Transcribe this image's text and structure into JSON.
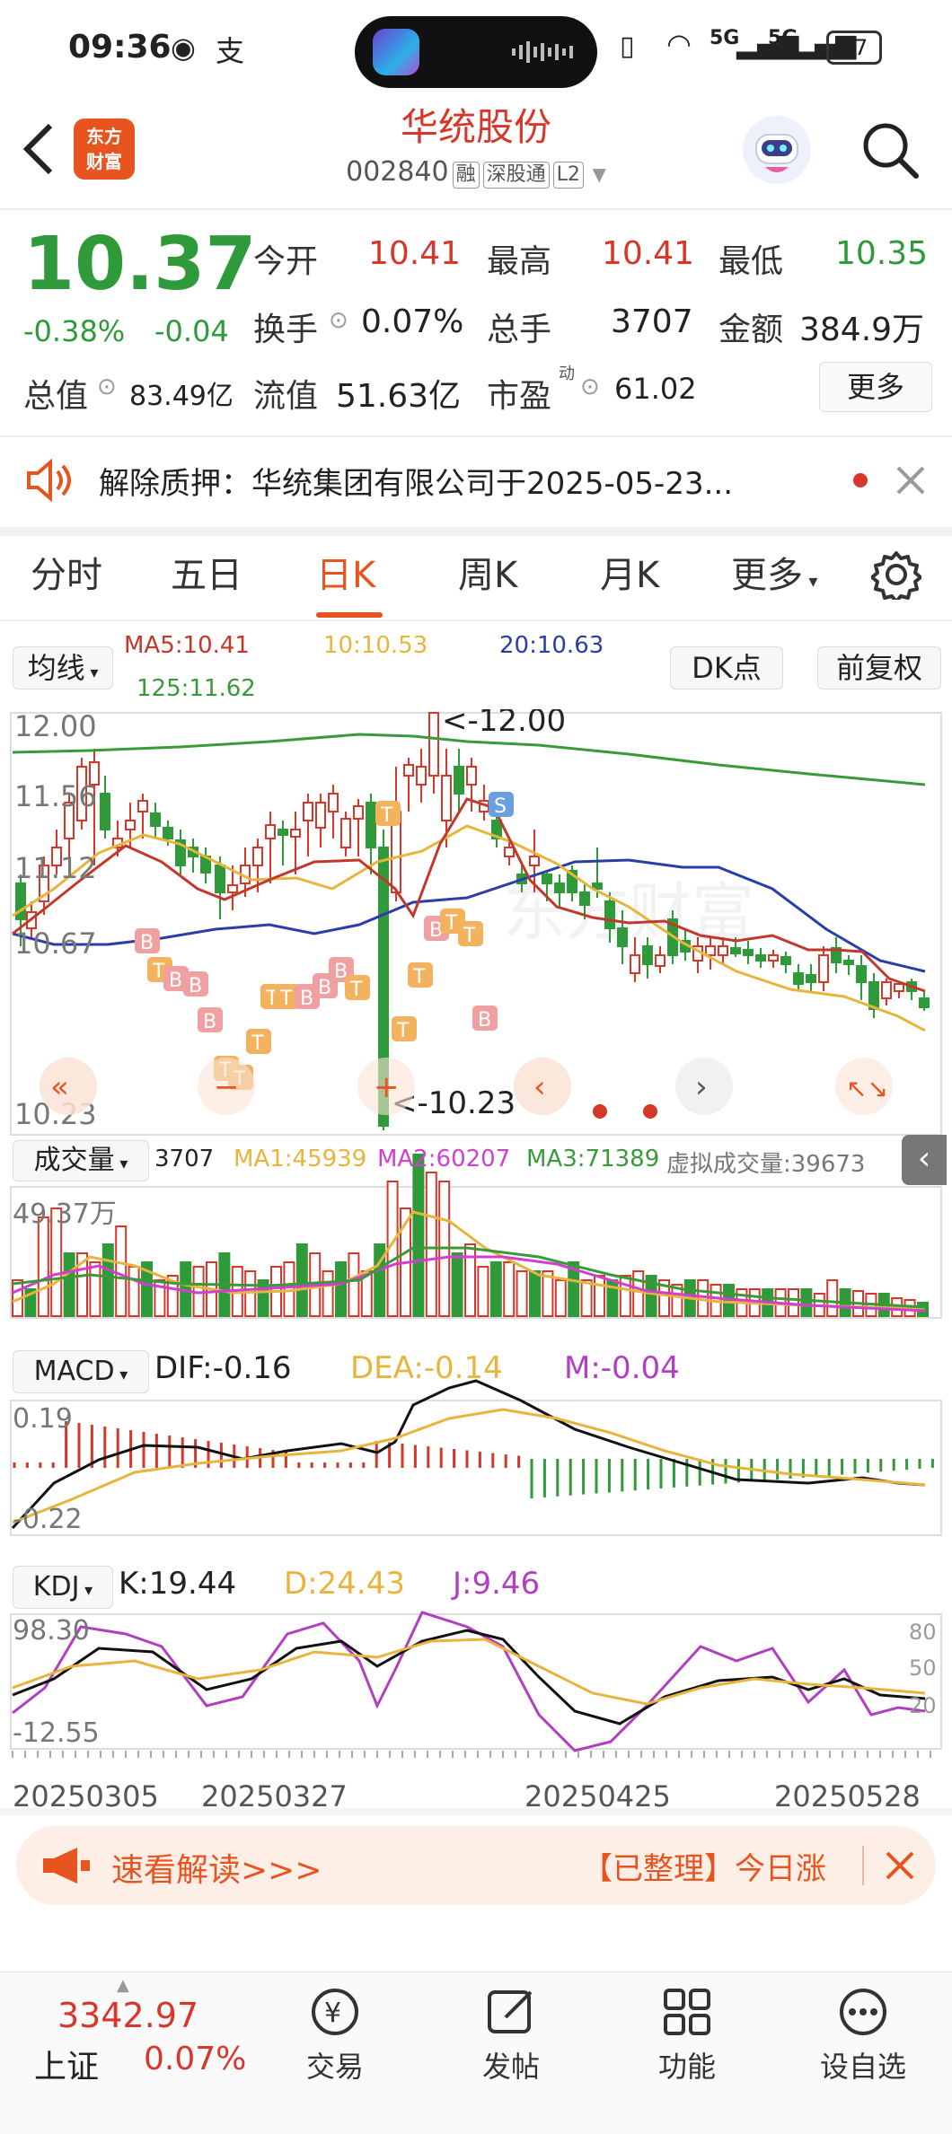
{
  "status": {
    "time": "09:36",
    "battery": "57",
    "signal1": "5G",
    "signal2": "5G"
  },
  "header": {
    "title": "华统股份",
    "code": "002840",
    "tags": [
      "融",
      "深股通",
      "L2"
    ],
    "logo_line1": "东方",
    "logo_line2": "财富"
  },
  "quote": {
    "price": "10.37",
    "change_pct": "-0.38%",
    "change": "-0.04",
    "open_label": "今开",
    "open": "10.41",
    "high_label": "最高",
    "high": "10.41",
    "low_label": "最低",
    "low": "10.35",
    "turnover_label": "换手",
    "turnover": "0.07%",
    "volume_label": "总手",
    "volume": "3707",
    "amount_label": "金额",
    "amount": "384.9万",
    "mktcap_label": "总值",
    "mktcap": "83.49亿",
    "float_label": "流值",
    "float": "51.63亿",
    "pe_label": "市盈",
    "pe_sup": "动",
    "pe": "61.02",
    "more_label": "更多"
  },
  "notice": {
    "text": "解除质押：华统集团有限公司于2025-05-23..."
  },
  "tabs": [
    {
      "label": "分时"
    },
    {
      "label": "五日"
    },
    {
      "label": "日K"
    },
    {
      "label": "周K"
    },
    {
      "label": "月K"
    },
    {
      "label": "更多"
    }
  ],
  "ma_legend": {
    "selector": "均线",
    "ma5": "MA5:10.41",
    "ma10": "10:10.53",
    "ma20": "20:10.63",
    "ma125": "125:11.62",
    "dk_btn": "DK点",
    "fq_btn": "前复权"
  },
  "kchart": {
    "y_high": "12.00",
    "y2": "11.56",
    "y3": "11.12",
    "y4": "10.67",
    "y_low": "10.23",
    "max_note": "<-12.00",
    "min_note": "<-10.23"
  },
  "volume_legend": {
    "selector": "成交量",
    "vol": "3707",
    "ma1": "MA1:45939",
    "ma2": "MA2:60207",
    "ma3": "MA3:71389",
    "virtual": "虚拟成交量:39673",
    "y_top": "49.37万"
  },
  "macd_legend": {
    "selector": "MACD",
    "dif": "DIF:-0.16",
    "dea": "DEA:-0.14",
    "m": "M:-0.04",
    "y_top": "0.19",
    "y_bottom": "-0.22"
  },
  "kdj_legend": {
    "selector": "KDJ",
    "k": "K:19.44",
    "d": "D:24.43",
    "j": "J:9.46",
    "y_top": "98.30",
    "y_bottom": "-12.55",
    "r80": "80",
    "r50": "50",
    "r20": "20"
  },
  "dates": [
    "20250305",
    "20250327",
    "20250425",
    "20250528"
  ],
  "banner": {
    "text": "速看解读>>>",
    "right": "【已整理】今日涨"
  },
  "bottom": {
    "index_value": "3342.97",
    "index_name": "上证",
    "index_pct": "0.07%",
    "nav": [
      "交易",
      "发帖",
      "功能",
      "设自选"
    ]
  },
  "colors": {
    "up": "#d7372b",
    "down": "#2e9a3a",
    "accent": "#e8541f",
    "ma10": "#e8b53c",
    "ma20": "#2a3ea8",
    "ma125": "#3a9a3a"
  }
}
